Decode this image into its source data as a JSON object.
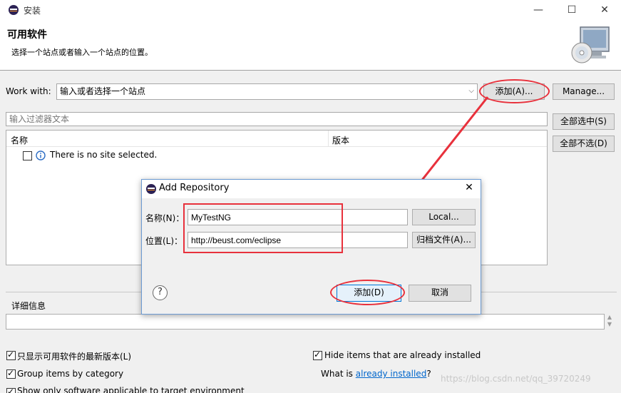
{
  "window": {
    "title": "安装",
    "minimize": "—",
    "maximize": "☐",
    "close": "✕"
  },
  "header": {
    "title": "可用软件",
    "subtitle": "选择一个站点或者输入一个站点的位置。"
  },
  "work_with": {
    "label": "Work with:",
    "value": "输入或者选择一个站点",
    "add_button": "添加(A)...",
    "manage_button": "Manage..."
  },
  "filter": {
    "placeholder": "输入过滤器文本",
    "select_all": "全部选中(S)",
    "deselect_all": "全部不选(D)"
  },
  "table": {
    "col_name": "名称",
    "col_version": "版本",
    "row_text": "There is no site selected."
  },
  "details": {
    "label": "详细信息"
  },
  "options": {
    "latest": "只显示可用软件的最新版本(L)",
    "group": "Group items by category",
    "applicable": "Show only software applicable to target environment",
    "hide_installed": "Hide items that are already installed",
    "what_is": "What is",
    "already_installed": "already installed",
    "question": "?"
  },
  "dialog": {
    "title": "Add Repository",
    "close": "✕",
    "name_label": "名称(N)：",
    "name_value": "MyTestNG",
    "local_button": "Local...",
    "location_label": "位置(L)：",
    "location_value": "http://beust.com/eclipse",
    "archive_button": "归档文件(A)...",
    "help": "?",
    "add_button": "添加(D)",
    "cancel_button": "取消"
  },
  "watermark": "https://blog.csdn.net/qq_39720249",
  "colors": {
    "annotation": "#e8313c",
    "link": "#0066cc",
    "dialog_border": "#6b9ad2"
  }
}
